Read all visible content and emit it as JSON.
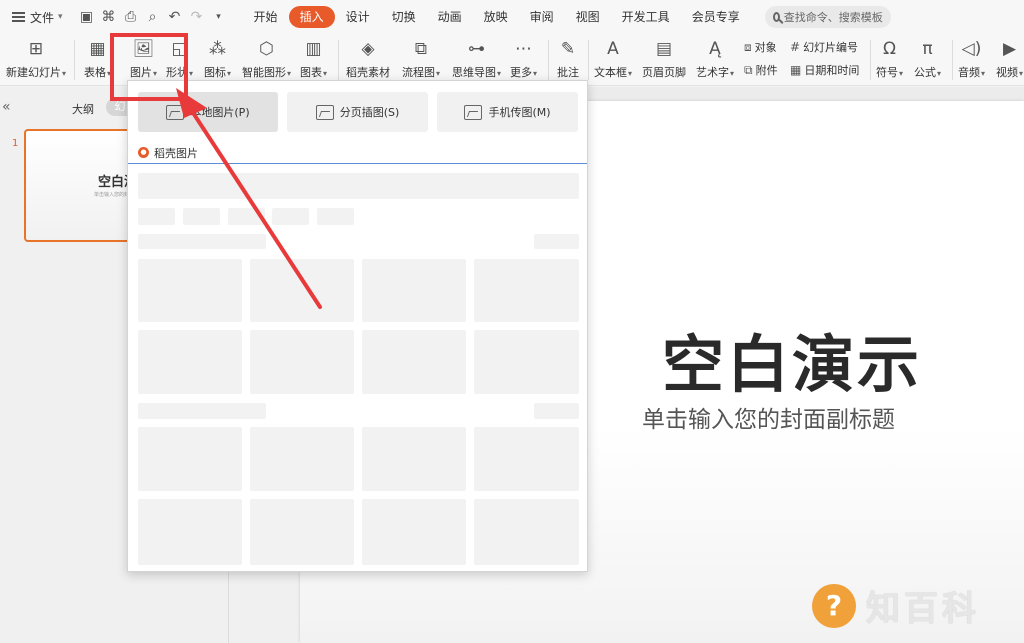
{
  "menubar": {
    "file_label": "文件",
    "tabs": [
      {
        "label": "开始",
        "active": false
      },
      {
        "label": "插入",
        "active": true
      },
      {
        "label": "设计",
        "active": false
      },
      {
        "label": "切换",
        "active": false
      },
      {
        "label": "动画",
        "active": false
      },
      {
        "label": "放映",
        "active": false
      },
      {
        "label": "审阅",
        "active": false
      },
      {
        "label": "视图",
        "active": false
      },
      {
        "label": "开发工具",
        "active": false
      },
      {
        "label": "会员专享",
        "active": false
      }
    ],
    "search_placeholder": "查找命令、搜索模板"
  },
  "ribbon": {
    "new_slide": "新建幻灯片",
    "table": "表格",
    "picture": "图片",
    "shape": "形状",
    "icon": "图标",
    "smartart": "智能图形",
    "chart": "图表",
    "daoke_material": "稻壳素材",
    "flowchart": "流程图",
    "mindmap": "思维导图",
    "more": "更多",
    "comment": "批注",
    "textbox": "文本框",
    "header_footer": "页眉页脚",
    "wordart": "艺术字",
    "object": "对象",
    "attachment": "附件",
    "slide_number": "幻灯片编号",
    "datetime": "日期和时间",
    "symbol": "符号",
    "formula": "公式",
    "audio": "音频",
    "video": "视频"
  },
  "leftpane": {
    "tab_outline": "大纲",
    "tab_slide": "幻",
    "slide_number": "1",
    "thumb_title": "空白演",
    "thumb_subtitle": "单击输入您的封"
  },
  "dropdown": {
    "local_picture": "本地图片(P)",
    "paged_illustration": "分页插图(S)",
    "phone_transfer": "手机传图(M)",
    "section_title": "稻壳图片"
  },
  "slide": {
    "title": "空白演示",
    "subtitle": "单击输入您的封面副标题"
  },
  "watermark": {
    "symbol": "?",
    "text": "知百科"
  },
  "colors": {
    "accent": "#e85a2a",
    "highlight": "#e83a3a",
    "section_line": "#5a8ed6"
  }
}
